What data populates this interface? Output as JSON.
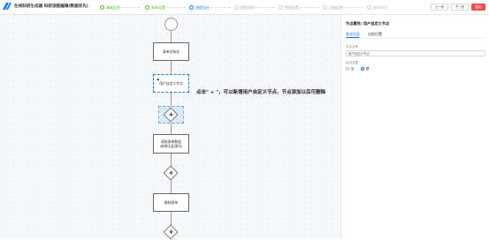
{
  "header": {
    "title": "在线科研生成器 科研流程编辑(数据优先)",
    "steps": [
      {
        "label": "基础信息",
        "state": "done"
      },
      {
        "label": "表单设置",
        "state": "done"
      },
      {
        "label": "流程设计",
        "state": "active"
      },
      {
        "label": "数据权限",
        "state": "todo"
      },
      {
        "label": "数据配置",
        "state": "todo"
      },
      {
        "label": "功能配置",
        "state": "todo"
      },
      {
        "label": "发布应用",
        "state": "todo"
      }
    ],
    "prev_label": "上一步",
    "next_label": "下一步",
    "save_label": "保存"
  },
  "flow": {
    "node_init": "表单初始化",
    "node_custom": "用户自定义节点",
    "node_data_line1": "获取表单数据",
    "node_data_line2": "(新增无此操作)",
    "node_delete": "删除表单",
    "plus_symbol": "+",
    "person_symbol": "⚑",
    "hint": "点击\" + \"，可以新增用户自定义节点，节点添加以后可删除"
  },
  "panel": {
    "title": "节点属性: 用户自定义节点",
    "tabs": [
      "基本信息",
      "出现位置"
    ],
    "name_label": "节点名称",
    "name_value": "用户自定义节点",
    "enable_label": "启动设置",
    "radio_off": "否",
    "radio_on": "是"
  },
  "colors": {
    "accent": "#1677ff",
    "done": "#52c41a",
    "danger": "#ff4d4f"
  }
}
